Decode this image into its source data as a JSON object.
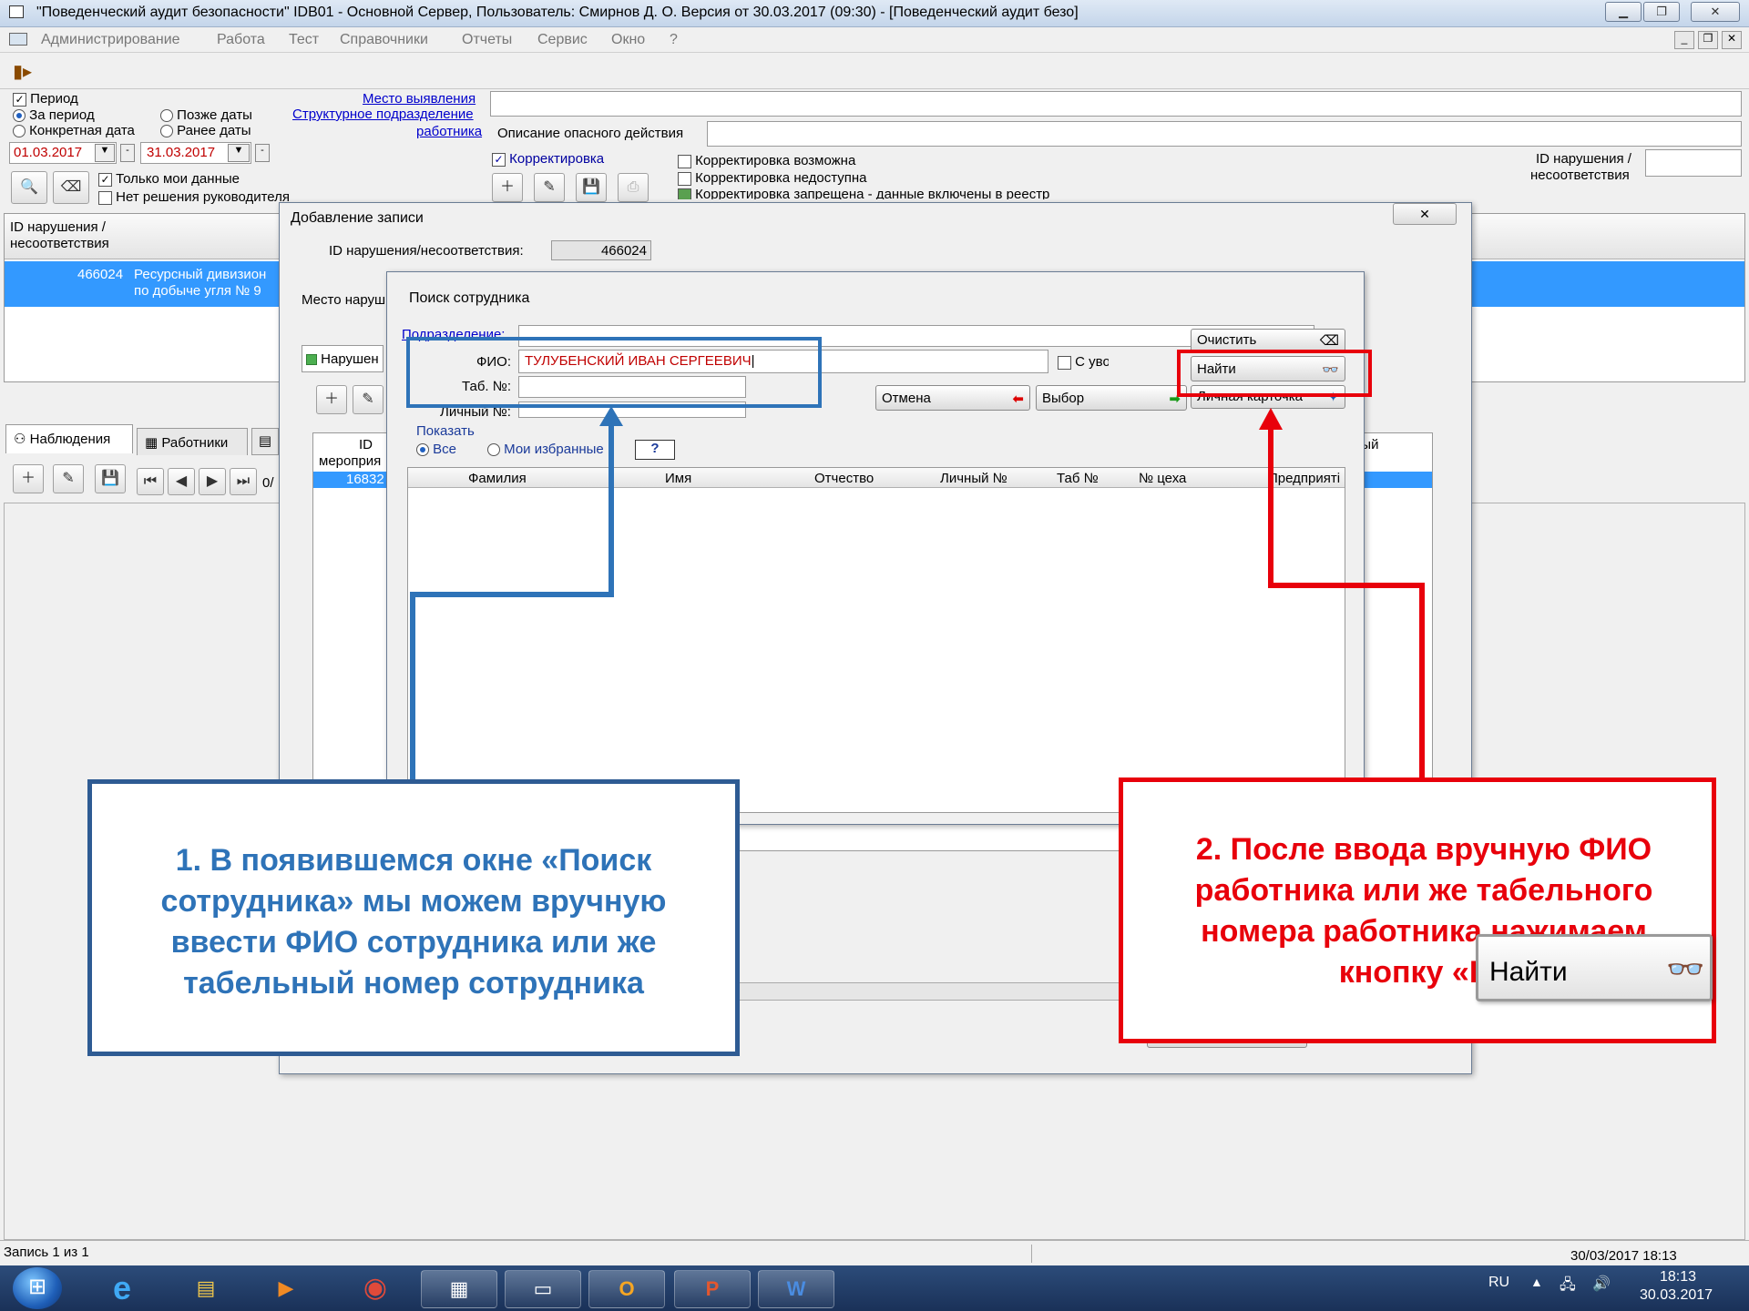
{
  "window": {
    "title": "\"Поведенческий аудит безопасности\"    IDB01 - Основной Сервер,    Пользователь: Смирнов Д. О.    Версия от 30.03.2017 (09:30) - [Поведенческий аудит безо]"
  },
  "menu": [
    "Администрирование",
    "Работа",
    "Тест",
    "Справочники",
    "Отчеты",
    "Сервис",
    "Окно",
    "?"
  ],
  "filters": {
    "period_label": "Период",
    "za_period": "За период",
    "konkretnaya_data": "Конкретная дата",
    "pozhe_daty": "Позже даты",
    "ranee_daty": "Ранее даты",
    "date_from": "01.03.2017",
    "date_to": "31.03.2017",
    "only_my_data": "Только мои данные",
    "no_decision": "Нет решения руководителя",
    "mesto_vyyavleniya": "Место выявления",
    "strukturnoe": "Структурное подразделение",
    "rabotnika": "работника",
    "opisanie": "Описание опасного действия",
    "korrektirovka": "Корректировка",
    "korr_vozmozhna": "Корректировка возможна",
    "korr_nedostupna": "Корректировка недоступна",
    "korr_zapreshena": "Корректировка запрещена - данные включены в реестр",
    "id_narusheniya": "ID нарушения /",
    "nesootvetstviya": "несоответствия"
  },
  "main_grid": {
    "header1": "ID нарушения /",
    "header2": "несоответствия",
    "row_id": "466024",
    "row_text1": "Ресурсный дивизион",
    "row_text2": "по добыче угля № 9"
  },
  "tabs": {
    "nablyudeniya": "Наблюдения",
    "rabotniki": "Работники"
  },
  "sub_grid": {
    "col1a": "ID",
    "col1b": "мероприя",
    "row_id": "16832",
    "nav_count": "0/"
  },
  "add_dialog": {
    "title": "Добавление записи",
    "id_label": "ID нарушения/несоответствия:",
    "id_value": "466024",
    "mesto_label": "Место наруш",
    "narush_tab": "Нарушен",
    "right_col": "ный"
  },
  "search_dialog": {
    "title": "Поиск сотрудника",
    "podrazdelenie": "Подразделение:",
    "fio_label": "ФИО:",
    "fio_value": "ТУЛУБЕНСКИЙ ИВАН СЕРГЕЕВИЧ",
    "tab_label": "Таб. №:",
    "lichny_label": "Личный №:",
    "s_uvolennymi": "С уволенными",
    "ochistit": "Очистить",
    "nayti": "Найти",
    "otmena": "Отмена",
    "vybor": "Выбор",
    "lichnaya_kartochka": "Личная карточка",
    "pokazat": "Показать",
    "vse": "Все",
    "moi_izbrannye": "Мои избранные",
    "help": "?",
    "columns": [
      "Фамилия",
      "Имя",
      "Отчество",
      "Личный №",
      "Таб №",
      "№ цеха",
      "Предприяті"
    ]
  },
  "callouts": {
    "blue": "1. В появившемся окне «Поиск сотрудника» мы можем вручную ввести ФИО сотрудника или же табельный номер сотрудника",
    "red": "2. После ввода вручную ФИО работника или же табельного номера работника нажимаем кнопку «На",
    "zoom_button": "Найти",
    "blue_color": "#2e73b8",
    "red_color": "#e8000b"
  },
  "status": {
    "record": "Запись  1  из  1",
    "datetime": "30/03/2017 18:13"
  },
  "taskbar": {
    "lang": "RU",
    "time": "18:13",
    "date": "30.03.2017"
  }
}
